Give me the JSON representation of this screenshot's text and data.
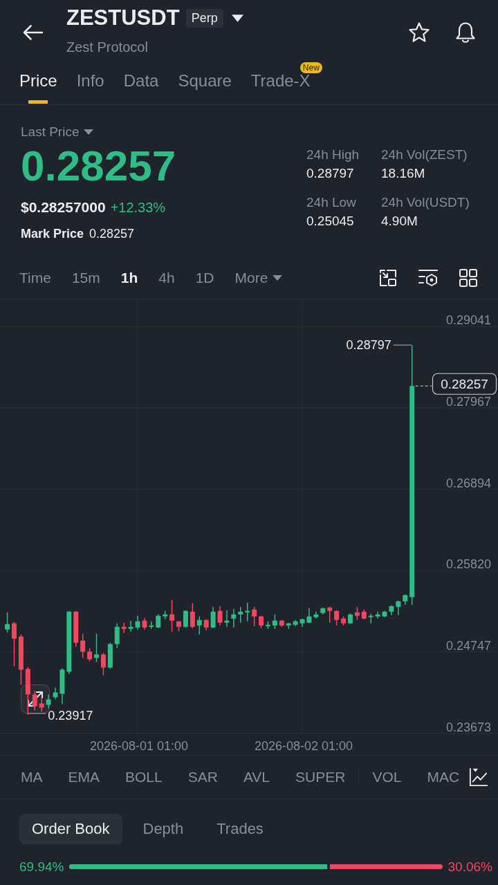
{
  "header": {
    "symbol": "ZESTUSDT",
    "contract_tag": "Perp",
    "subtitle": "Zest Protocol"
  },
  "tabs": [
    {
      "label": "Price",
      "selected": true
    },
    {
      "label": "Info",
      "selected": false
    },
    {
      "label": "Data",
      "selected": false
    },
    {
      "label": "Square",
      "selected": false
    },
    {
      "label": "Trade-X",
      "selected": false,
      "badge": "New"
    }
  ],
  "price_panel": {
    "selector": "Last Price",
    "last_price": "0.28257",
    "fiat_price": "$0.28257000",
    "change": "+12.33%",
    "mark_price_label": "Mark Price",
    "mark_price": "0.28257",
    "stats": [
      {
        "label": "24h High",
        "value": "0.28797"
      },
      {
        "label": "24h Vol(ZEST)",
        "value": "18.16M"
      },
      {
        "label": "24h Low",
        "value": "0.25045"
      },
      {
        "label": "24h Vol(USDT)",
        "value": "4.90M"
      }
    ]
  },
  "intervals": [
    {
      "label": "Time",
      "selected": false,
      "kind": "option"
    },
    {
      "label": "15m",
      "selected": false,
      "kind": "option"
    },
    {
      "label": "1h",
      "selected": true,
      "kind": "option"
    },
    {
      "label": "4h",
      "selected": false,
      "kind": "option"
    },
    {
      "label": "1D",
      "selected": false,
      "kind": "option"
    },
    {
      "label": "More",
      "selected": false,
      "kind": "menu"
    }
  ],
  "chart": {
    "chart_data": {
      "type": "candlestick",
      "categories": [
        null,
        null,
        null,
        null,
        null,
        null,
        null,
        null,
        null,
        null,
        null,
        null,
        null,
        null,
        null,
        null,
        null,
        null,
        null,
        "2026-08-01 01:00",
        null,
        null,
        null,
        null,
        null,
        null,
        null,
        null,
        null,
        null,
        null,
        null,
        null,
        null,
        null,
        null,
        null,
        null,
        null,
        null,
        null,
        null,
        null,
        "2026-08-02 01:00",
        null,
        null,
        null,
        null,
        null,
        null,
        null,
        null,
        null,
        null,
        null,
        null,
        null,
        null,
        null,
        null
      ],
      "ohlc": [
        [
          0.25042,
          0.25269,
          0.25005,
          0.25114
        ],
        [
          0.25124,
          0.25142,
          0.24559,
          0.24923
        ],
        [
          0.2495,
          0.24978,
          0.24313,
          0.24513
        ],
        [
          0.24522,
          0.2455,
          0.23917,
          0.24185
        ],
        [
          0.24185,
          0.24231,
          0.23976,
          0.2403
        ],
        [
          0.24067,
          0.2414,
          0.23957,
          0.24012
        ],
        [
          0.24048,
          0.24185,
          0.24003,
          0.24121
        ],
        [
          0.24149,
          0.24276,
          0.24121,
          0.24212
        ],
        [
          0.24194,
          0.24531,
          0.24058,
          0.24513
        ],
        [
          0.24486,
          0.25288,
          0.24458,
          0.25278
        ],
        [
          0.25278,
          0.25288,
          0.24814,
          0.24868
        ],
        [
          0.24896,
          0.24987,
          0.24668,
          0.2475
        ],
        [
          0.2475,
          0.24796,
          0.24622,
          0.2465
        ],
        [
          0.24668,
          0.24987,
          0.24613,
          0.24714
        ],
        [
          0.24714,
          0.24732,
          0.2444,
          0.2454
        ],
        [
          0.2454,
          0.24868,
          0.24522,
          0.2485
        ],
        [
          0.2485,
          0.25124,
          0.24796,
          0.25078
        ],
        [
          0.25078,
          0.25133,
          0.24996,
          0.25051
        ],
        [
          0.25051,
          0.2516,
          0.25014,
          0.25078
        ],
        [
          0.25069,
          0.25224,
          0.25042,
          0.25151
        ],
        [
          0.2516,
          0.25196,
          0.25042,
          0.25069
        ],
        [
          0.25078,
          0.25151,
          0.25051,
          0.25096
        ],
        [
          0.25069,
          0.25242,
          0.2506,
          0.25224
        ],
        [
          0.25215,
          0.25288,
          0.25178,
          0.25242
        ],
        [
          0.25242,
          0.25433,
          0.25014,
          0.2516
        ],
        [
          0.25151,
          0.25151,
          0.25023,
          0.25078
        ],
        [
          0.25078,
          0.25297,
          0.25069,
          0.25288
        ],
        [
          0.25278,
          0.25388,
          0.2506,
          0.25078
        ],
        [
          0.25096,
          0.25215,
          0.24978,
          0.25169
        ],
        [
          0.25169,
          0.25178,
          0.25032,
          0.25069
        ],
        [
          0.25069,
          0.25342,
          0.2506,
          0.25278
        ],
        [
          0.25288,
          0.25351,
          0.25096,
          0.25133
        ],
        [
          0.25133,
          0.25297,
          0.25078,
          0.2516
        ],
        [
          0.25187,
          0.25315,
          0.25069,
          0.25242
        ],
        [
          0.25242,
          0.25342,
          0.25133,
          0.25278
        ],
        [
          0.25269,
          0.25397,
          0.25151,
          0.25288
        ],
        [
          0.25306,
          0.25342,
          0.25087,
          0.25215
        ],
        [
          0.25215,
          0.25224,
          0.2506,
          0.25096
        ],
        [
          0.25087,
          0.25151,
          0.25051,
          0.25105
        ],
        [
          0.25096,
          0.25242,
          0.25051,
          0.2516
        ],
        [
          0.2516,
          0.25169,
          0.25078,
          0.25096
        ],
        [
          0.25096,
          0.25133,
          0.25051,
          0.25124
        ],
        [
          0.25105,
          0.25169,
          0.25087,
          0.25151
        ],
        [
          0.25124,
          0.25187,
          0.25078,
          0.25178
        ],
        [
          0.25133,
          0.25324,
          0.25124,
          0.25215
        ],
        [
          0.25206,
          0.25278,
          0.25187,
          0.25242
        ],
        [
          0.2526,
          0.25333,
          0.25242,
          0.25324
        ],
        [
          0.25333,
          0.25342,
          0.25133,
          0.25288
        ],
        [
          0.25288,
          0.25297,
          0.25096,
          0.25169
        ],
        [
          0.25187,
          0.25215,
          0.25096,
          0.25124
        ],
        [
          0.25124,
          0.25251,
          0.25114,
          0.25242
        ],
        [
          0.25269,
          0.25342,
          0.25169,
          0.25224
        ],
        [
          0.25278,
          0.25306,
          0.25178,
          0.25187
        ],
        [
          0.25206,
          0.25251,
          0.25124,
          0.25224
        ],
        [
          0.25215,
          0.25278,
          0.25187,
          0.25242
        ],
        [
          0.25215,
          0.25288,
          0.25206,
          0.25278
        ],
        [
          0.25278,
          0.2536,
          0.25233,
          0.25351
        ],
        [
          0.25342,
          0.25424,
          0.25233,
          0.25415
        ],
        [
          0.25415,
          0.25506,
          0.2537,
          0.25497
        ],
        [
          0.2547,
          0.28797,
          0.2537,
          0.28257
        ]
      ],
      "ylim": [
        0.2366,
        0.294
      ],
      "yticks": [
        {
          "value": 0.29041,
          "label": "0.29041"
        },
        {
          "value": 0.27967,
          "label": "0.27967"
        },
        {
          "value": 0.26894,
          "label": "0.26894"
        },
        {
          "value": 0.2582,
          "label": "0.25820"
        },
        {
          "value": 0.24747,
          "label": "0.24747"
        },
        {
          "value": 0.23673,
          "label": "0.23673"
        }
      ],
      "grid": true
    },
    "high_label": "0.28797",
    "low_label": "0.23917",
    "last_price_tag": "0.28257"
  },
  "indicators": {
    "main": [
      "MA",
      "EMA",
      "BOLL",
      "SAR",
      "AVL",
      "SUPER"
    ],
    "sub": [
      "VOL",
      "MAC"
    ]
  },
  "book_tabs": [
    {
      "label": "Order Book",
      "selected": true
    },
    {
      "label": "Depth",
      "selected": false
    },
    {
      "label": "Trades",
      "selected": false
    }
  ],
  "order_ratio": {
    "buy": "69.94%",
    "sell": "30.06%",
    "level": 0.6994
  }
}
